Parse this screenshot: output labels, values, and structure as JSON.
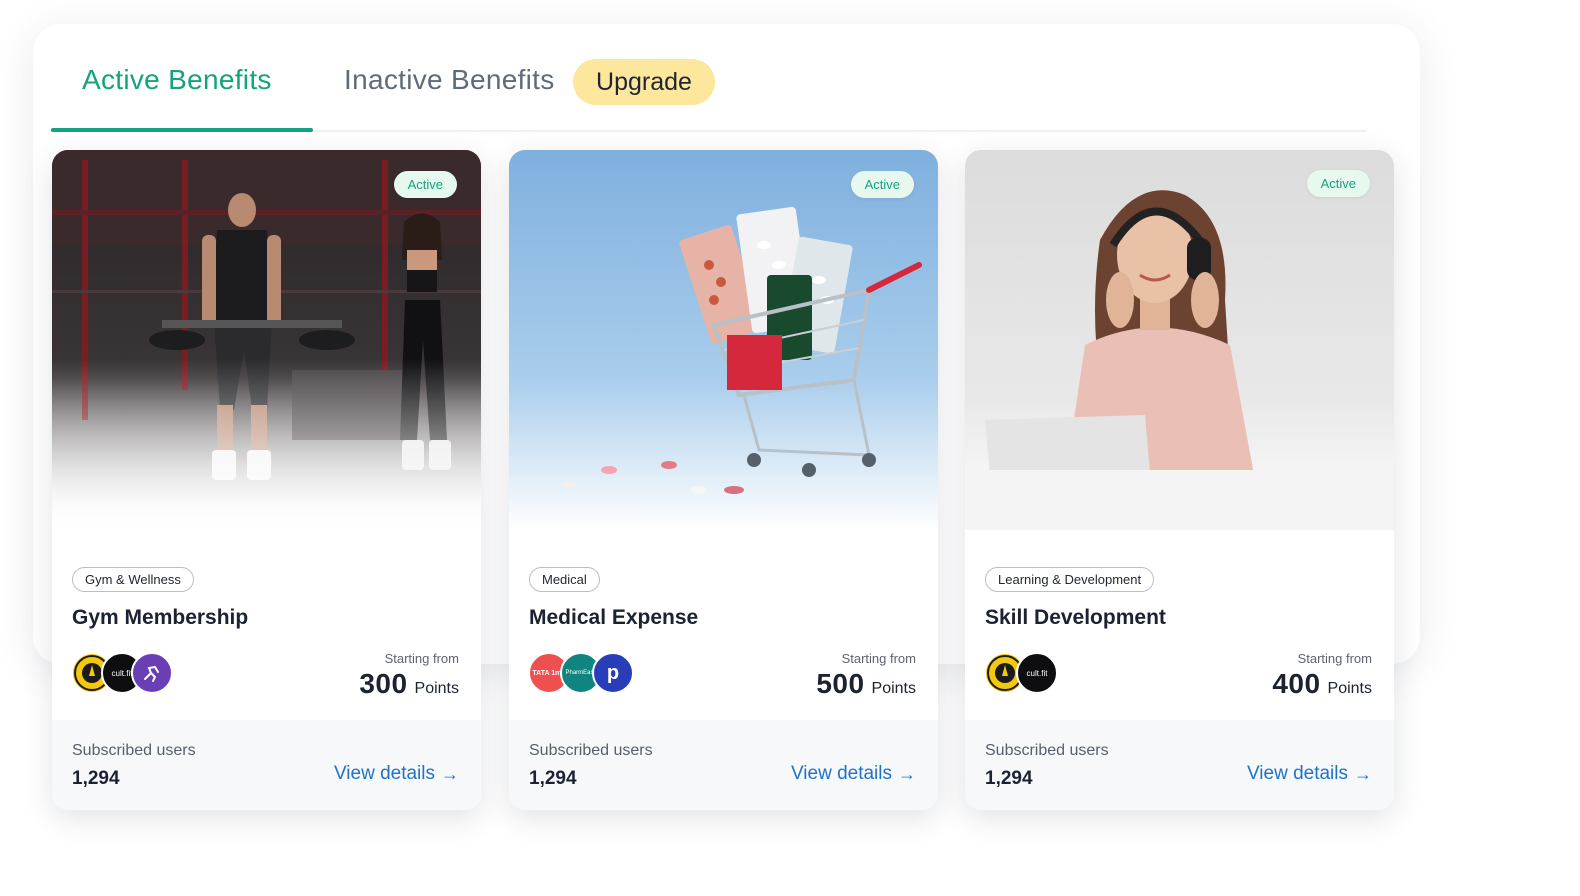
{
  "tabs": {
    "active_label": "Active Benefits",
    "inactive_label": "Inactive Benefits",
    "upgrade_label": "Upgrade"
  },
  "cards": [
    {
      "badge": "Active",
      "category": "Gym & Wellness",
      "title": "Gym Membership",
      "starting_label": "Starting from",
      "points": "300",
      "points_unit": "Points",
      "subscribed_label": "Subscribed users",
      "subscribed_value": "1,294",
      "cta": "View details",
      "logos": [
        "golds-gym-logo",
        "cult-fit-logo",
        "fitness-app-logo"
      ],
      "logo_texts": [
        "",
        "cult.fit",
        ""
      ]
    },
    {
      "badge": "Active",
      "category": "Medical",
      "title": "Medical Expense",
      "starting_label": "Starting from",
      "points": "500",
      "points_unit": "Points",
      "subscribed_label": "Subscribed users",
      "subscribed_value": "1,294",
      "cta": "View details",
      "logos": [
        "tata-1mg-logo",
        "pharmeasy-logo",
        "practo-logo"
      ],
      "logo_texts": [
        "TATA 1mg",
        "PharmEasy",
        "p"
      ]
    },
    {
      "badge": "Active",
      "category": "Learning & Development",
      "title": "Skill Development",
      "starting_label": "Starting from",
      "points": "400",
      "points_unit": "Points",
      "subscribed_label": "Subscribed users",
      "subscribed_value": "1,294",
      "cta": "View details",
      "logos": [
        "golds-gym-logo",
        "cult-fit-logo"
      ],
      "logo_texts": [
        "",
        "cult.fit"
      ]
    }
  ],
  "colors": {
    "accent": "#14a37f",
    "upgrade_bg": "#fde79c",
    "link": "#1f73c7",
    "badge_bg": "#e7f8ee"
  }
}
